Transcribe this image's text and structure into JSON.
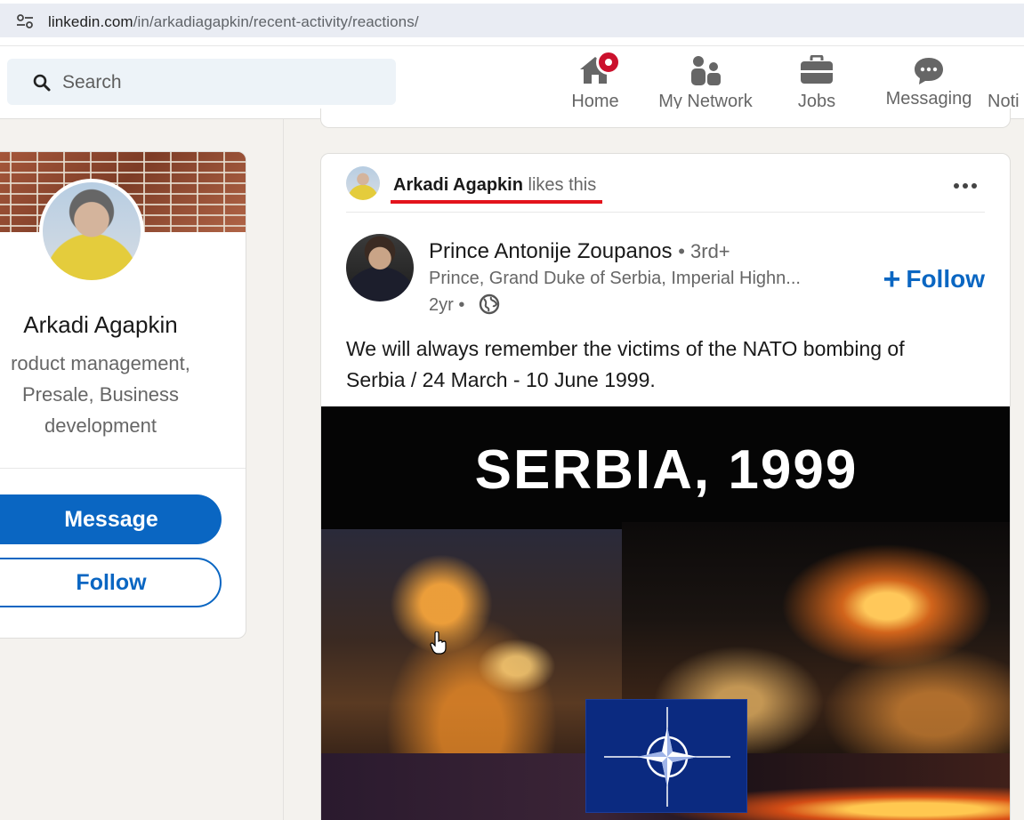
{
  "browser": {
    "url_host": "linkedin.com",
    "url_path": "/in/arkadiagapkin/recent-activity/reactions/"
  },
  "header": {
    "search_placeholder": "Search",
    "nav": [
      {
        "label": "Home",
        "icon": "home-icon"
      },
      {
        "label": "My Network",
        "icon": "network-icon"
      },
      {
        "label": "Jobs",
        "icon": "briefcase-icon"
      },
      {
        "label": "Messaging",
        "icon": "messaging-icon"
      },
      {
        "label": "Noti",
        "icon": "bell-icon"
      }
    ],
    "accent_color": "#0a66c2",
    "badge_color": "#cb112d"
  },
  "profile": {
    "name": "Arkadi Agapkin",
    "headline": "roduct management,\nPresale, Business\ndevelopment",
    "message_label": "Message",
    "follow_label": "Follow"
  },
  "post": {
    "reactor_name": "Arkadi Agapkin",
    "reaction_suffix": "likes this",
    "actor_name": "Prince Antonije Zoupanos",
    "actor_degree": "• 3rd+",
    "actor_subtitle": "Prince, Grand Duke of Serbia, Imperial Highn...",
    "actor_time": "2yr •",
    "follow_label": "Follow",
    "text": "We will always remember the victims of the NATO bombing of Serbia / 24 March - 10 June 1999.",
    "image_title": "SERBIA, 1999"
  }
}
